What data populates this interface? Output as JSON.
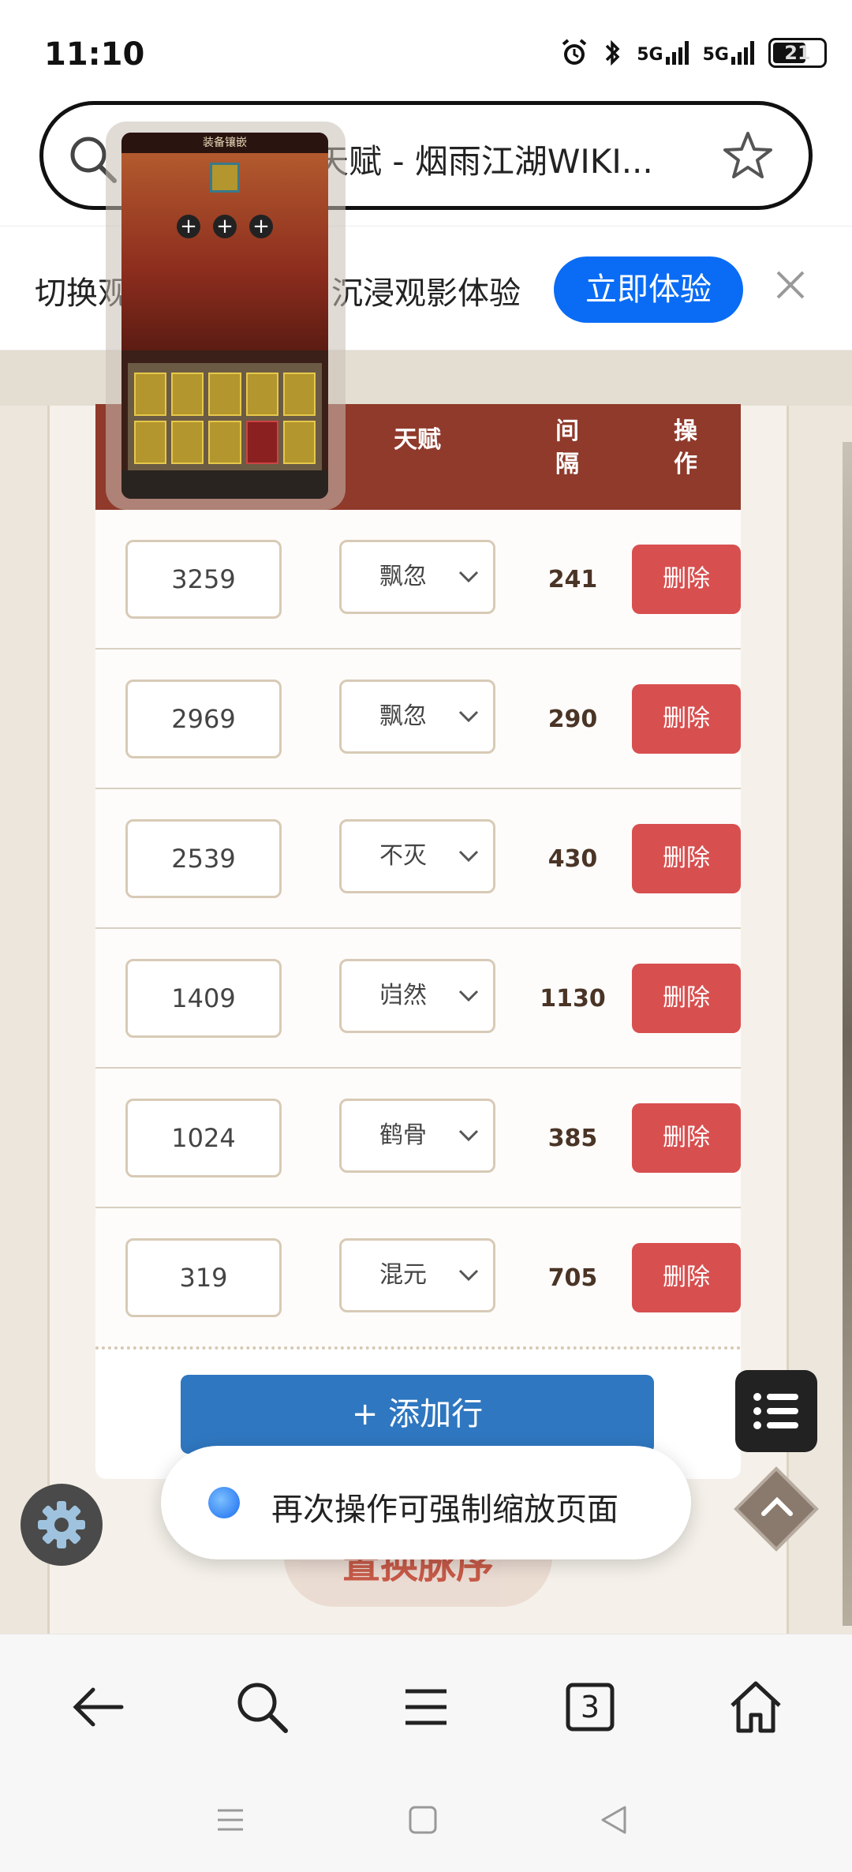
{
  "status_bar": {
    "time": "11:10",
    "sig1": "5G",
    "sig2": "5G",
    "battery": "21"
  },
  "address_bar": {
    "title": "天赋 - 烟雨江湖WIKI..."
  },
  "banner": {
    "text_left": "切换观",
    "text_right": "沉浸观影体验",
    "button": "立即体验"
  },
  "thumbnail": {
    "title": "装备镶嵌"
  },
  "table": {
    "headers": {
      "talent": "天赋",
      "interval": "间隔",
      "action": "操作"
    },
    "rows": [
      {
        "value": "3259",
        "talent": "飘忽",
        "interval": "241",
        "action": "删除"
      },
      {
        "value": "2969",
        "talent": "飘忽",
        "interval": "290",
        "action": "删除"
      },
      {
        "value": "2539",
        "talent": "不灭",
        "interval": "430",
        "action": "删除"
      },
      {
        "value": "1409",
        "talent": "岿然",
        "interval": "1130",
        "action": "删除"
      },
      {
        "value": "1024",
        "talent": "鹤骨",
        "interval": "385",
        "action": "删除"
      },
      {
        "value": "319",
        "talent": "混元",
        "interval": "705",
        "action": "删除"
      }
    ],
    "add_row": "+ 添加行"
  },
  "behind_button": "置换脉序",
  "toast": {
    "text": "再次操作可强制缩放页面"
  },
  "bottom_nav": {
    "tab_count": "3"
  },
  "colors": {
    "header_bg": "#8f3a2b",
    "delete_btn": "#d84f4f",
    "add_row_btn": "#2f77c0",
    "banner_btn": "#0a6cf5"
  }
}
